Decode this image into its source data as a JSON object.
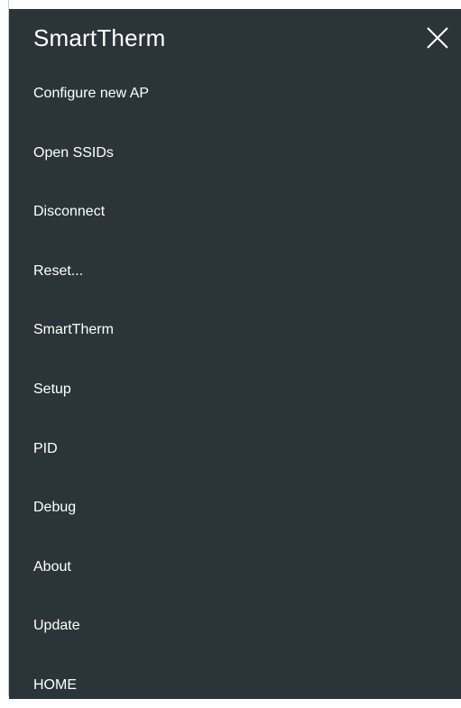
{
  "drawer": {
    "title": "SmartTherm",
    "close_icon": "close-icon",
    "background_color": "#2b3539",
    "items": [
      {
        "label": "Configure new AP"
      },
      {
        "label": "Open SSIDs"
      },
      {
        "label": "Disconnect"
      },
      {
        "label": "Reset..."
      },
      {
        "label": "SmartTherm"
      },
      {
        "label": "Setup"
      },
      {
        "label": "PID"
      },
      {
        "label": "Debug"
      },
      {
        "label": "About"
      },
      {
        "label": "Update"
      },
      {
        "label": "HOME"
      }
    ]
  }
}
